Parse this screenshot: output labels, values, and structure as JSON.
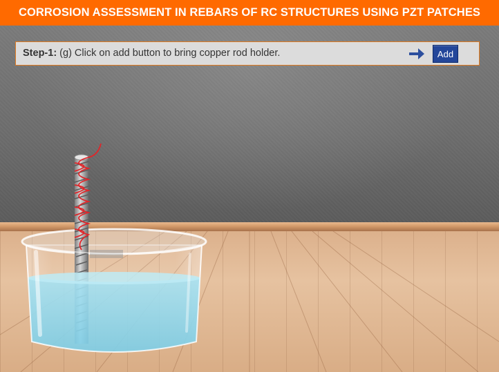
{
  "header": {
    "title": "CORROSION ASSESSMENT IN REBARS OF RC STRUCTURES USING PZT PATCHES"
  },
  "instruction": {
    "step_label": "Step-1:",
    "step_text": " (g) Click on add button to bring copper rod holder."
  },
  "controls": {
    "add_label": "Add",
    "arrow_icon": "arrow-right-icon"
  },
  "colors": {
    "header_bg": "#ff6a00",
    "button_bg": "#24479a",
    "arrow": "#2c4f9e",
    "wire": "#e0262a",
    "water": "#8fd6ea"
  },
  "scene": {
    "objects": [
      "glass-beaker",
      "water",
      "rebar",
      "copper-wire-coil"
    ]
  }
}
